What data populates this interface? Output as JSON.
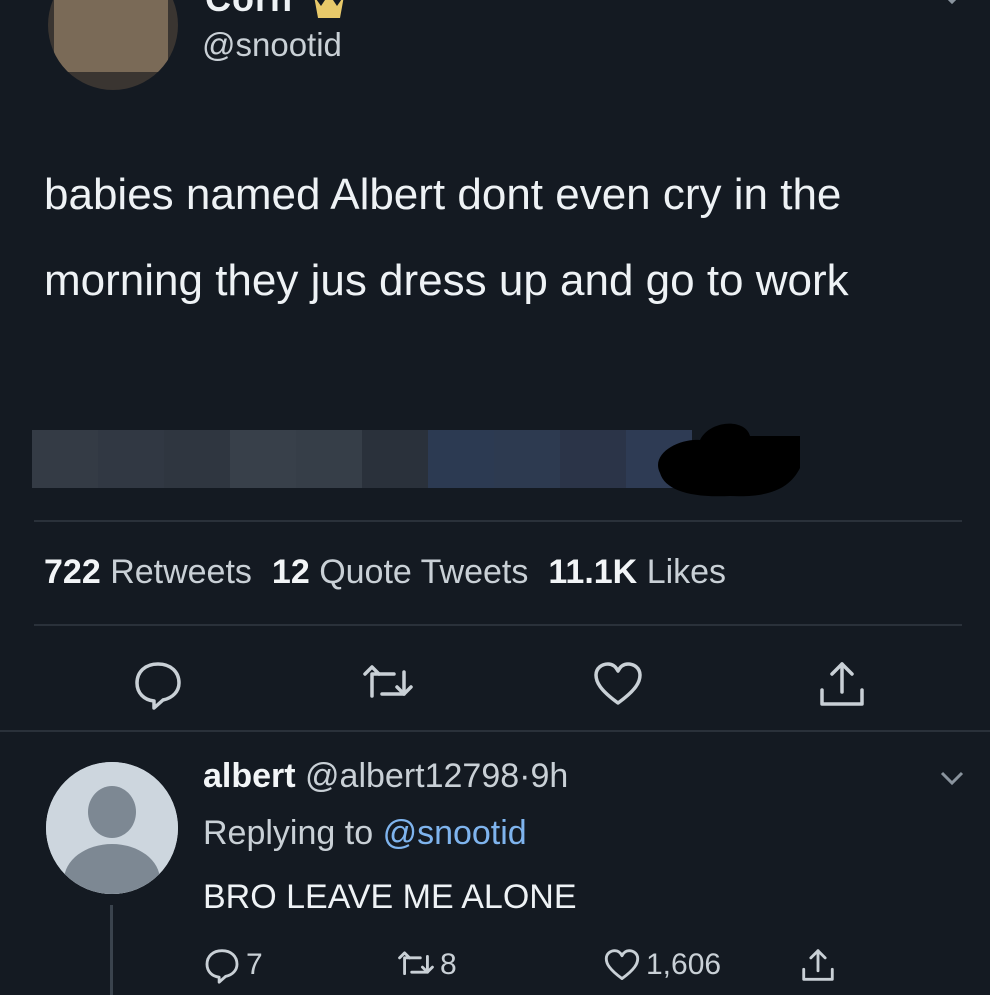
{
  "tweet": {
    "display_name": "Corn",
    "handle": "@snootid",
    "text": "babies named Albert dont even cry in the morning they jus dress up and go to work",
    "stats": {
      "retweets_count": "722",
      "retweets_label": "Retweets",
      "quotes_count": "12",
      "quotes_label": "Quote Tweets",
      "likes_count": "11.1K",
      "likes_label": "Likes"
    },
    "actions": [
      "reply-icon",
      "retweet-icon",
      "like-icon",
      "share-icon"
    ]
  },
  "reply": {
    "display_name": "albert",
    "handle": "@albert12798",
    "separator": "·",
    "time": "9h",
    "replying_to_label": "Replying to",
    "replying_to_handle": "@snootid",
    "text": "BRO LEAVE ME ALONE",
    "reply_count": "7",
    "retweet_count": "8",
    "like_count": "1,606"
  },
  "colors": {
    "background": "#141a22",
    "text": "#eef2f5",
    "muted": "#c9d0d6",
    "mention": "#7fb4ee",
    "divider": "#2a313a"
  }
}
